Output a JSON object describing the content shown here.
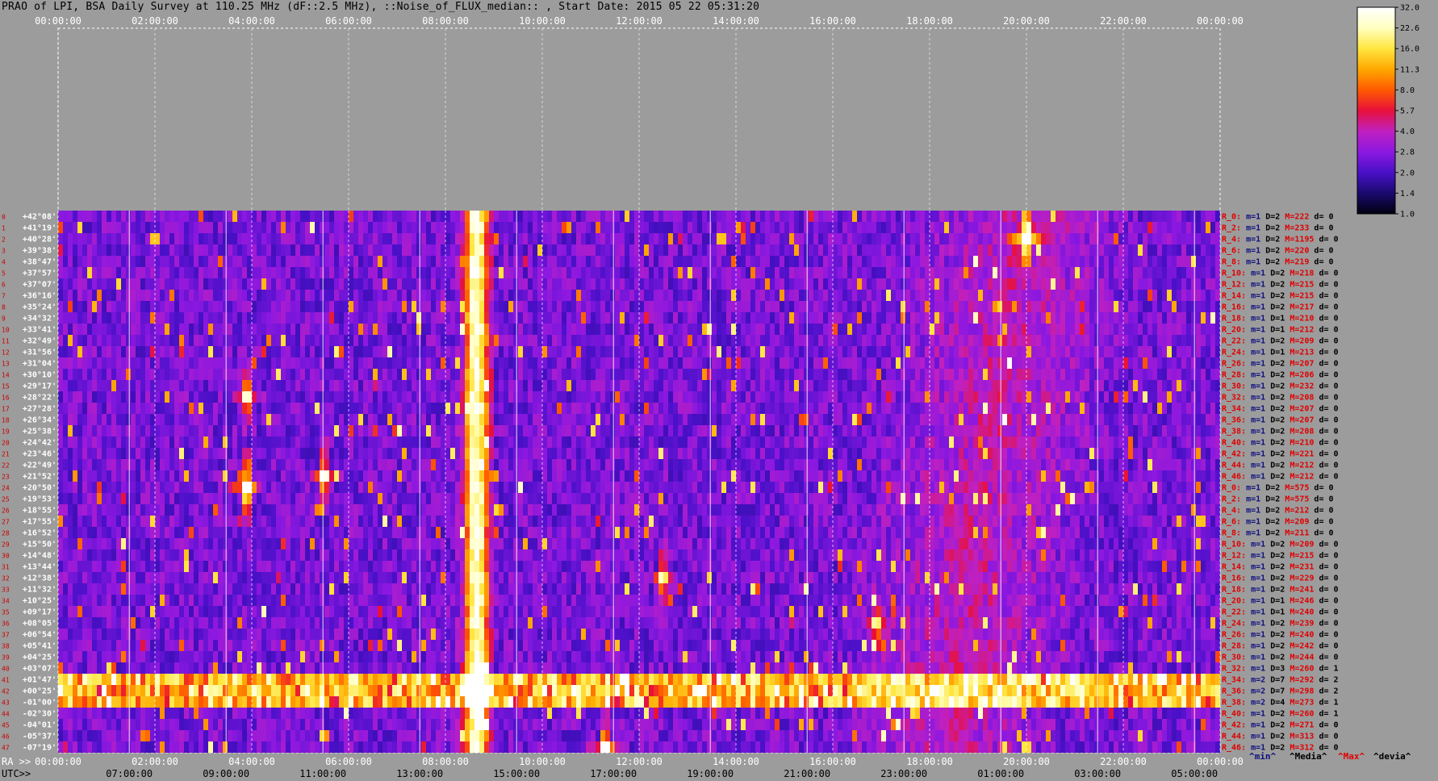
{
  "title": "PRAO of LPI, BSA Daily Survey at 110.25 MHz (dF::2.5 MHz), ::Noise_of_FLUX_median:: , Start Date: 2015 05 22 05:31:20",
  "chart_data": {
    "type": "heatmap",
    "title": "PRAO of LPI, BSA Daily Survey at 110.25 MHz (dF::2.5 MHz), ::Noise_of_FLUX_median:: , Start Date: 2015 05 22 05:31:20",
    "ra_ticks": [
      "00:00:00",
      "02:00:00",
      "04:00:00",
      "06:00:00",
      "08:00:00",
      "10:00:00",
      "12:00:00",
      "14:00:00",
      "16:00:00",
      "18:00:00",
      "20:00:00",
      "22:00:00",
      "00:00:00"
    ],
    "ra_ticks_bottom": [
      "00:00:00",
      "02:00:00",
      "04:00:00",
      "06:00:00",
      "08:00:00",
      "10:00:00",
      "12:00:00",
      "14:00:00",
      "16:00:00",
      "18:00:00",
      "20:00:00",
      "22:00:00",
      "00:00:00"
    ],
    "utc_ticks": [
      "07:00:00",
      "09:00:00",
      "11:00:00",
      "13:00:00",
      "15:00:00",
      "17:00:00",
      "19:00:00",
      "21:00:00",
      "23:00:00",
      "01:00:00",
      "03:00:00",
      "05:00:00"
    ],
    "x_axis_label": "RA >>",
    "utc_axis_label": "UTC>>",
    "declinations": [
      "+42°08'",
      "+41°19'",
      "+40°28'",
      "+39°38'",
      "+38°47'",
      "+37°57'",
      "+37°07'",
      "+36°16'",
      "+35°24'",
      "+34°32'",
      "+33°41'",
      "+32°49'",
      "+31°56'",
      "+31°04'",
      "+30°10'",
      "+29°17'",
      "+28°22'",
      "+27°28'",
      "+26°34'",
      "+25°38'",
      "+24°42'",
      "+23°46'",
      "+22°49'",
      "+21°52'",
      "+20°50'",
      "+19°53'",
      "+18°55'",
      "+17°55'",
      "+16°52'",
      "+15°50'",
      "+14°48'",
      "+13°44'",
      "+12°38'",
      "+11°32'",
      "+10°25'",
      "+09°17'",
      "+08°05'",
      "+06°54'",
      "+05°41'",
      "+04°25'",
      "+03°07'",
      "+01°47'",
      "+00°25'",
      "-01°00'",
      "-02°30'",
      "-04°01'",
      "-05°37'",
      "-07°19'"
    ],
    "beam_indices": [
      "0",
      "1",
      "2",
      "3",
      "4",
      "5",
      "6",
      "7",
      "8",
      "9",
      "10",
      "11",
      "12",
      "13",
      "14",
      "15",
      "16",
      "17",
      "18",
      "19",
      "20",
      "21",
      "22",
      "23",
      "24",
      "25",
      "26",
      "27",
      "28",
      "29",
      "30",
      "31",
      "32",
      "33",
      "34",
      "35",
      "36",
      "37",
      "38",
      "39",
      "40",
      "41",
      "42",
      "43",
      "44",
      "45",
      "46",
      "47"
    ],
    "row_stats": [
      {
        "r": "R_0:",
        "m": "m=1",
        "d": "D=2",
        "M": "M=222",
        "dev": "d= 0"
      },
      {
        "r": "R_2:",
        "m": "m=1",
        "d": "D=2",
        "M": "M=233",
        "dev": "d= 0"
      },
      {
        "r": "R_4:",
        "m": "m=1",
        "d": "D=2",
        "M": "M=1195",
        "dev": "d= 0"
      },
      {
        "r": "R_6:",
        "m": "m=1",
        "d": "D=2",
        "M": "M=220",
        "dev": "d= 0"
      },
      {
        "r": "R_8:",
        "m": "m=1",
        "d": "D=2",
        "M": "M=219",
        "dev": "d= 0"
      },
      {
        "r": "R_10:",
        "m": "m=1",
        "d": "D=2",
        "M": "M=218",
        "dev": "d= 0"
      },
      {
        "r": "R_12:",
        "m": "m=1",
        "d": "D=2",
        "M": "M=215",
        "dev": "d= 0"
      },
      {
        "r": "R_14:",
        "m": "m=1",
        "d": "D=2",
        "M": "M=215",
        "dev": "d= 0"
      },
      {
        "r": "R_16:",
        "m": "m=1",
        "d": "D=2",
        "M": "M=217",
        "dev": "d= 0"
      },
      {
        "r": "R_18:",
        "m": "m=1",
        "d": "D=1",
        "M": "M=210",
        "dev": "d= 0"
      },
      {
        "r": "R_20:",
        "m": "m=1",
        "d": "D=1",
        "M": "M=212",
        "dev": "d= 0"
      },
      {
        "r": "R_22:",
        "m": "m=1",
        "d": "D=2",
        "M": "M=209",
        "dev": "d= 0"
      },
      {
        "r": "R_24:",
        "m": "m=1",
        "d": "D=1",
        "M": "M=213",
        "dev": "d= 0"
      },
      {
        "r": "R_26:",
        "m": "m=1",
        "d": "D=2",
        "M": "M=207",
        "dev": "d= 0"
      },
      {
        "r": "R_28:",
        "m": "m=1",
        "d": "D=2",
        "M": "M=206",
        "dev": "d= 0"
      },
      {
        "r": "R_30:",
        "m": "m=1",
        "d": "D=2",
        "M": "M=232",
        "dev": "d= 0"
      },
      {
        "r": "R_32:",
        "m": "m=1",
        "d": "D=2",
        "M": "M=208",
        "dev": "d= 0"
      },
      {
        "r": "R_34:",
        "m": "m=1",
        "d": "D=2",
        "M": "M=207",
        "dev": "d= 0"
      },
      {
        "r": "R_36:",
        "m": "m=1",
        "d": "D=2",
        "M": "M=207",
        "dev": "d= 0"
      },
      {
        "r": "R_38:",
        "m": "m=1",
        "d": "D=2",
        "M": "M=208",
        "dev": "d= 0"
      },
      {
        "r": "R_40:",
        "m": "m=1",
        "d": "D=2",
        "M": "M=210",
        "dev": "d= 0"
      },
      {
        "r": "R_42:",
        "m": "m=1",
        "d": "D=2",
        "M": "M=221",
        "dev": "d= 0"
      },
      {
        "r": "R_44:",
        "m": "m=1",
        "d": "D=2",
        "M": "M=212",
        "dev": "d= 0"
      },
      {
        "r": "R_46:",
        "m": "m=1",
        "d": "D=2",
        "M": "M=212",
        "dev": "d= 0"
      },
      {
        "r": "R_0:",
        "m": "m=1",
        "d": "D=2",
        "M": "M=575",
        "dev": "d= 0"
      },
      {
        "r": "R_2:",
        "m": "m=1",
        "d": "D=2",
        "M": "M=575",
        "dev": "d= 0"
      },
      {
        "r": "R_4:",
        "m": "m=1",
        "d": "D=2",
        "M": "M=212",
        "dev": "d= 0"
      },
      {
        "r": "R_6:",
        "m": "m=1",
        "d": "D=2",
        "M": "M=209",
        "dev": "d= 0"
      },
      {
        "r": "R_8:",
        "m": "m=1",
        "d": "D=2",
        "M": "M=211",
        "dev": "d= 0"
      },
      {
        "r": "R_10:",
        "m": "m=1",
        "d": "D=2",
        "M": "M=209",
        "dev": "d= 0"
      },
      {
        "r": "R_12:",
        "m": "m=1",
        "d": "D=2",
        "M": "M=215",
        "dev": "d= 0"
      },
      {
        "r": "R_14:",
        "m": "m=1",
        "d": "D=2",
        "M": "M=231",
        "dev": "d= 0"
      },
      {
        "r": "R_16:",
        "m": "m=1",
        "d": "D=2",
        "M": "M=229",
        "dev": "d= 0"
      },
      {
        "r": "R_18:",
        "m": "m=1",
        "d": "D=2",
        "M": "M=241",
        "dev": "d= 0"
      },
      {
        "r": "R_20:",
        "m": "m=1",
        "d": "D=1",
        "M": "M=246",
        "dev": "d= 0"
      },
      {
        "r": "R_22:",
        "m": "m=1",
        "d": "D=1",
        "M": "M=240",
        "dev": "d= 0"
      },
      {
        "r": "R_24:",
        "m": "m=1",
        "d": "D=2",
        "M": "M=239",
        "dev": "d= 0"
      },
      {
        "r": "R_26:",
        "m": "m=1",
        "d": "D=2",
        "M": "M=240",
        "dev": "d= 0"
      },
      {
        "r": "R_28:",
        "m": "m=1",
        "d": "D=2",
        "M": "M=242",
        "dev": "d= 0"
      },
      {
        "r": "R_30:",
        "m": "m=1",
        "d": "D=2",
        "M": "M=244",
        "dev": "d= 0"
      },
      {
        "r": "R_32:",
        "m": "m=1",
        "d": "D=3",
        "M": "M=260",
        "dev": "d= 1"
      },
      {
        "r": "R_34:",
        "m": "m=2",
        "d": "D=7",
        "M": "M=292",
        "dev": "d= 2"
      },
      {
        "r": "R_36:",
        "m": "m=2",
        "d": "D=7",
        "M": "M=298",
        "dev": "d= 2"
      },
      {
        "r": "R_38:",
        "m": "m=2",
        "d": "D=4",
        "M": "M=273",
        "dev": "d= 1"
      },
      {
        "r": "R_40:",
        "m": "m=1",
        "d": "D=2",
        "M": "M=260",
        "dev": "d= 1"
      },
      {
        "r": "R_42:",
        "m": "m=1",
        "d": "D=2",
        "M": "M=271",
        "dev": "d= 0"
      },
      {
        "r": "R_44:",
        "m": "m=1",
        "d": "D=2",
        "M": "M=313",
        "dev": "d= 0"
      },
      {
        "r": "R_46:",
        "m": "m=1",
        "d": "D=2",
        "M": "M=312",
        "dev": "d= 0"
      }
    ],
    "stats_legend": [
      "^min^",
      "^Media^",
      "^Max^",
      "^devia^"
    ],
    "colorbar": {
      "ticks": [
        "32.0",
        "22.6",
        "16.0",
        "11.3",
        "8.0",
        "5.7",
        "4.0",
        "2.8",
        "2.0",
        "1.4",
        "1.0"
      ],
      "colors": [
        "#000010",
        "#1a0a6e",
        "#4a10c8",
        "#8c18e0",
        "#c020c0",
        "#e8103a",
        "#ff5a00",
        "#ffa800",
        "#ffe640",
        "#ffffc0",
        "#ffffff"
      ]
    },
    "features": [
      {
        "ra_hours": 8.7,
        "kind": "vertical-band",
        "strength": 0.9
      },
      {
        "ra_hours": 8.55,
        "kind": "vertical-band",
        "strength": 0.6
      },
      {
        "ra_hours": 20.0,
        "dec_row": 2,
        "kind": "point-source",
        "strength": 1.0
      },
      {
        "ra_hours": 3.9,
        "dec_row": 24,
        "kind": "point-source",
        "strength": 1.0
      },
      {
        "ra_hours": 8.7,
        "dec_row": 42,
        "kind": "point-source",
        "strength": 1.0
      },
      {
        "ra_hours": 5.5,
        "dec_row": 23,
        "kind": "point-source",
        "strength": 0.7
      },
      {
        "ra_hours": 12.5,
        "dec_row": 32,
        "kind": "point-source",
        "strength": 0.6
      },
      {
        "ra_hours": 3.9,
        "dec_row": 16,
        "kind": "point-source",
        "strength": 0.6
      },
      {
        "ra_hours": 16.9,
        "dec_row": 36,
        "kind": "point-source",
        "strength": 0.5
      },
      {
        "ra_hours": 11.3,
        "dec_row": 47,
        "kind": "point-source",
        "strength": 0.8
      },
      {
        "dec_row": 14.5,
        "kind": "horizontal-line",
        "strength": 0.55
      },
      {
        "dec_rows": [
          41,
          42,
          43
        ],
        "kind": "horizontal-band",
        "strength": 0.8
      }
    ]
  }
}
